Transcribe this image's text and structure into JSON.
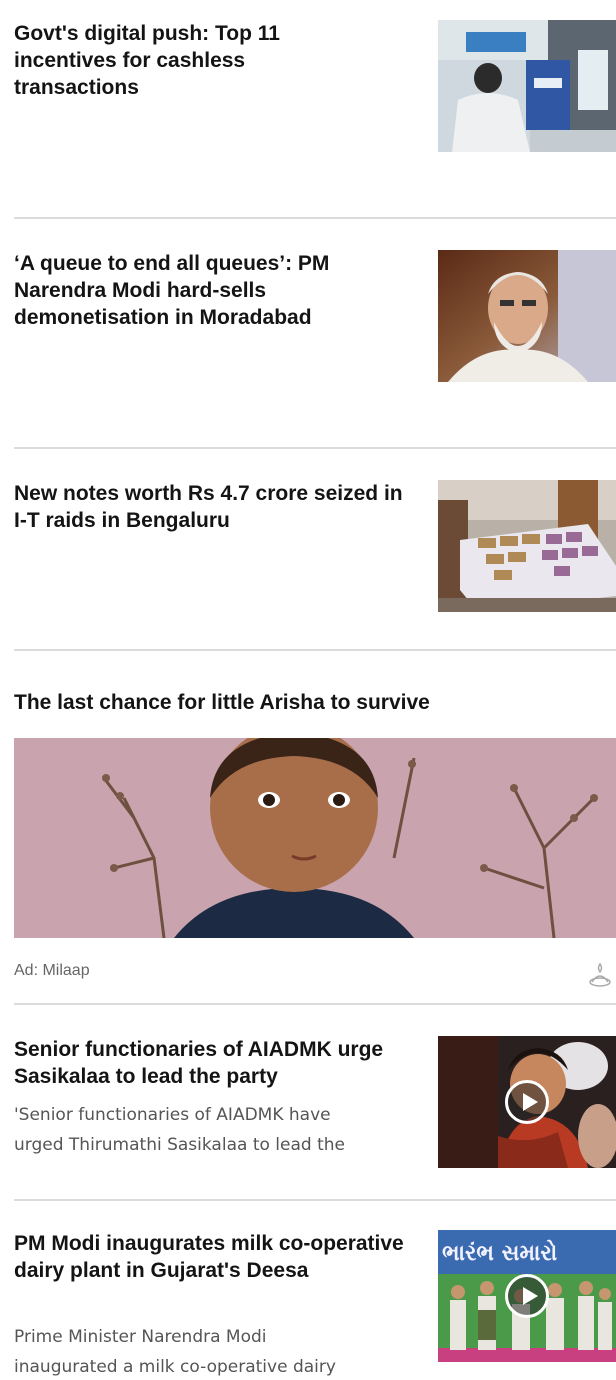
{
  "feed": {
    "stories": [
      {
        "headline": "Govt's digital push: Top 11 incentives for cashless transactions",
        "thumbnail": "atm-kiosk-photo",
        "has_video": false
      },
      {
        "headline": "‘A queue to end all queues’: PM Narendra Modi hard-sells demonetisation in Moradabad",
        "thumbnail": "modi-portrait-photo",
        "has_video": false
      },
      {
        "headline": "New notes worth Rs 4.7 crore seized in I-T raids in Bengaluru",
        "thumbnail": "seized-notes-bed-photo",
        "has_video": false
      }
    ],
    "ad": {
      "title": "The last chance for little Arisha to survive",
      "label": "Ad: Milaap",
      "image": "child-portrait-photo",
      "icon": "ad-choices-icon"
    },
    "video_stories": [
      {
        "headline": "Senior functionaries of AIADMK urge Sasikalaa to lead the party",
        "snippet_line1": "'Senior functionaries of AIADMK have",
        "snippet_line2": "urged Thirumathi Sasikalaa to lead the",
        "thumbnail": "sasikala-crowd-photo",
        "has_video": true
      },
      {
        "headline": "PM Modi inaugurates milk co-operative dairy plant in Gujarat's Deesa",
        "snippet_line1": "Prime Minister Narendra Modi",
        "snippet_line2": "inaugurated a milk co-operative dairy",
        "thumbnail": "dairy-inauguration-photo",
        "banner_text": "ભારંભ સમારો",
        "has_video": true
      }
    ]
  },
  "colors": {
    "divider": "#dcdcdc",
    "headline": "#141414",
    "snippet": "#555555",
    "ad_bg": "#c9a3ad"
  }
}
